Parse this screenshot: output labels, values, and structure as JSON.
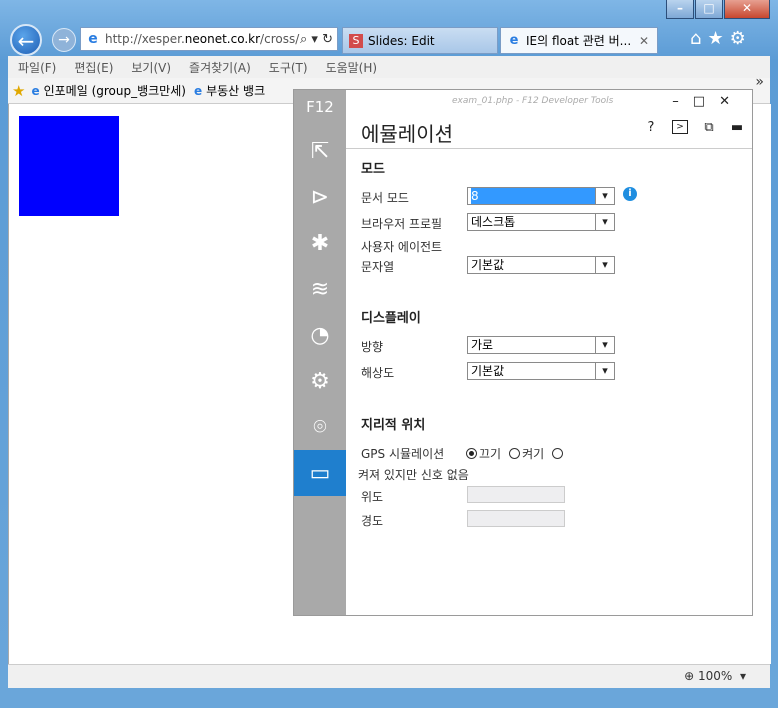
{
  "window": {
    "minimize": "–",
    "maximize": "□",
    "close": "✕"
  },
  "nav": {
    "url_prefix": "http://xesper.",
    "url_domain": "neonet.co.kr",
    "url_suffix": "/cross/",
    "tabs": [
      {
        "label": "Slides: Edit",
        "icon": "slides-icon"
      },
      {
        "label": "IE의 float 관련 버...",
        "icon": "ie-icon"
      }
    ]
  },
  "menu": {
    "items": [
      "파일(F)",
      "편집(E)",
      "보기(V)",
      "즐겨찾기(A)",
      "도구(T)",
      "도움말(H)"
    ]
  },
  "favorites": {
    "items": [
      "인포메일 (group_뱅크만세)",
      "부동산 뱅크"
    ]
  },
  "page": {
    "box_color": "#0000ff"
  },
  "status": {
    "zoom": "100%"
  },
  "devtools": {
    "f12_label": "F12",
    "window_title": "exam_01.php - F12 Developer Tools",
    "heading": "에뮬레이션",
    "help": "?",
    "sections": {
      "mode": "모드",
      "display": "디스플레이",
      "geo": "지리적 위치"
    },
    "mode": {
      "doc_mode_label": "문서 모드",
      "doc_mode_value": "8",
      "browser_profile_label": "브라우저 프로필",
      "browser_profile_value": "데스크톱",
      "ua_label_1": "사용자 에이전트",
      "ua_label_2": "문자열",
      "ua_value": "기본값"
    },
    "display": {
      "orientation_label": "방향",
      "orientation_value": "가로",
      "resolution_label": "해상도",
      "resolution_value": "기본값"
    },
    "geo": {
      "gps_label": "GPS 시뮬레이션",
      "off": "끄기",
      "on": "켜기",
      "no_signal": "켜져 있지만 신호 없음",
      "lat_label": "위도",
      "lon_label": "경도"
    },
    "accent": "#1f7fce"
  }
}
